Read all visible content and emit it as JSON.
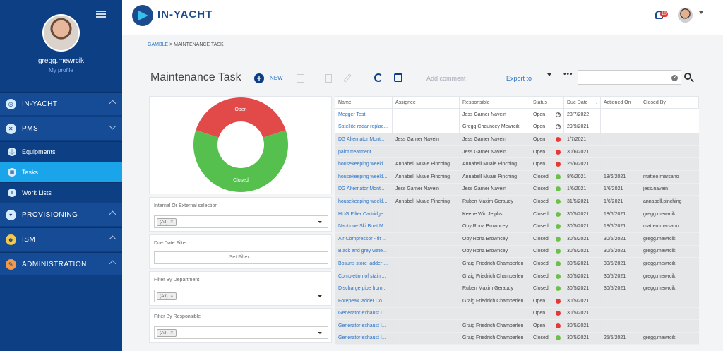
{
  "sidebar": {
    "username": "gregg.mewrcik",
    "my_profile": "My profile",
    "items": [
      {
        "label": "IN-YACHT",
        "icon": "compass-icon"
      },
      {
        "label": "PMS",
        "icon": "tools-icon"
      },
      {
        "label": "Equipments",
        "icon": "anchor-icon"
      },
      {
        "label": "Tasks",
        "icon": "calendar-icon"
      },
      {
        "label": "Work Lists",
        "icon": "list-icon"
      },
      {
        "label": "PROVISIONING",
        "icon": "basket-icon"
      },
      {
        "label": "ISM",
        "icon": "people-icon"
      },
      {
        "label": "ADMINISTRATION",
        "icon": "wrench-icon"
      }
    ]
  },
  "header": {
    "app_name": "IN-YACHT",
    "notification_count": "10"
  },
  "breadcrumb": {
    "parent": "GAMBLE",
    "sep": " > ",
    "current": "MAINTENANCE TASK"
  },
  "toolbar": {
    "title": "Maintenance Task",
    "new_label": "NEW",
    "add_comment": "Add comment",
    "export_to": "Export to",
    "more": "•••"
  },
  "chart_data": {
    "type": "pie",
    "style": "donut",
    "categories": [
      "Open",
      "Closed"
    ],
    "values": [
      40,
      60
    ],
    "colors": [
      "#e24a4a",
      "#56c04e"
    ]
  },
  "filters": {
    "internal_external": {
      "label": "Internal Or External selection",
      "chip": "(All)"
    },
    "due_date": {
      "label": "Due Date Filter",
      "button": "Set Filter..."
    },
    "department": {
      "label": "Filter By Department",
      "chip": "(All)"
    },
    "responsible": {
      "label": "Filter By Responsible",
      "chip": "(All)"
    }
  },
  "grid": {
    "columns": [
      "Name",
      "Assignee",
      "Responsible",
      "Status",
      "Due Date",
      "Actioned On",
      "Closed By"
    ],
    "rows": [
      {
        "name": "Megger Test",
        "assignee": "",
        "responsible": "Jess Garner Navein",
        "status": "Open",
        "ind": "pie",
        "due": "23/7/2022",
        "actioned": "",
        "closed_by": "",
        "grey": false
      },
      {
        "name": "Satellite radar replac...",
        "assignee": "",
        "responsible": "Gregg Chauncey Mewrcik",
        "status": "Open",
        "ind": "pie",
        "due": "29/9/2021",
        "actioned": "",
        "closed_by": "",
        "grey": false
      },
      {
        "name": "DG Alternator Mont...",
        "assignee": "Jess Garner Navein",
        "responsible": "Jess Garner Navein",
        "status": "Open",
        "ind": "red",
        "due": "1/7/2021",
        "actioned": "",
        "closed_by": "",
        "grey": true
      },
      {
        "name": "paint treatment",
        "assignee": "",
        "responsible": "Jess Garner Navein",
        "status": "Open",
        "ind": "red",
        "due": "30/6/2021",
        "actioned": "",
        "closed_by": "",
        "grey": true
      },
      {
        "name": "housekeeping weekl...",
        "assignee": "Annabell Muaie Pinching",
        "responsible": "Annabell Muaie Pinching",
        "status": "Open",
        "ind": "red",
        "due": "25/6/2021",
        "actioned": "",
        "closed_by": "",
        "grey": true
      },
      {
        "name": "housekeeping weekl...",
        "assignee": "Annabell Muaie Pinching",
        "responsible": "Annabell Muaie Pinching",
        "status": "Closed",
        "ind": "green",
        "due": "8/6/2021",
        "actioned": "18/6/2021",
        "closed_by": "matteo.marsano",
        "grey": true
      },
      {
        "name": "DG Alternator Mont...",
        "assignee": "Jess Garner Navein",
        "responsible": "Jess Garner Navein",
        "status": "Closed",
        "ind": "green",
        "due": "1/6/2021",
        "actioned": "1/6/2021",
        "closed_by": "jess.navein",
        "grey": true
      },
      {
        "name": "housekeeping weekl...",
        "assignee": "Annabell Muaie Pinching",
        "responsible": "Ruben Maxim Geraudy",
        "status": "Closed",
        "ind": "green",
        "due": "31/5/2021",
        "actioned": "1/6/2021",
        "closed_by": "annabell.pinching",
        "grey": true
      },
      {
        "name": "HUG Filter Cartridge...",
        "assignee": "",
        "responsible": "Keene Win Jelphs",
        "status": "Closed",
        "ind": "green",
        "due": "30/5/2021",
        "actioned": "18/6/2021",
        "closed_by": "gregg.mewrcik",
        "grey": true
      },
      {
        "name": "Nautique Ski Boat M...",
        "assignee": "",
        "responsible": "Oby Rona Browncey",
        "status": "Closed",
        "ind": "green",
        "due": "30/5/2021",
        "actioned": "18/6/2021",
        "closed_by": "matteo.marsano",
        "grey": true
      },
      {
        "name": "Air Compressor - fit ...",
        "assignee": "",
        "responsible": "Oby Rona Browncey",
        "status": "Closed",
        "ind": "green",
        "due": "30/5/2021",
        "actioned": "30/5/2021",
        "closed_by": "gregg.mewrcik",
        "grey": true
      },
      {
        "name": "Black and grey wate...",
        "assignee": "",
        "responsible": "Oby Rona Browncey",
        "status": "Closed",
        "ind": "green",
        "due": "30/5/2021",
        "actioned": "30/5/2021",
        "closed_by": "gregg.mewrcik",
        "grey": true
      },
      {
        "name": "Bosuns store ladder ...",
        "assignee": "",
        "responsible": "Graig Friedrich Champerlen",
        "status": "Closed",
        "ind": "green",
        "due": "30/5/2021",
        "actioned": "30/5/2021",
        "closed_by": "gregg.mewrcik",
        "grey": true
      },
      {
        "name": "Completion of stainl...",
        "assignee": "",
        "responsible": "Graig Friedrich Champerlen",
        "status": "Closed",
        "ind": "green",
        "due": "30/5/2021",
        "actioned": "30/5/2021",
        "closed_by": "gregg.mewrcik",
        "grey": true
      },
      {
        "name": "Discharge pipe from...",
        "assignee": "",
        "responsible": "Ruben Maxim Geraudy",
        "status": "Closed",
        "ind": "green",
        "due": "30/5/2021",
        "actioned": "30/5/2021",
        "closed_by": "gregg.mewrcik",
        "grey": true
      },
      {
        "name": "Forepeak ladder Co...",
        "assignee": "",
        "responsible": "Graig Friedrich Champerlen",
        "status": "Open",
        "ind": "red",
        "due": "30/5/2021",
        "actioned": "",
        "closed_by": "",
        "grey": true
      },
      {
        "name": "Generator exhaust I...",
        "assignee": "",
        "responsible": "",
        "status": "Open",
        "ind": "red",
        "due": "30/5/2021",
        "actioned": "",
        "closed_by": "",
        "grey": true
      },
      {
        "name": "Generator exhaust I...",
        "assignee": "",
        "responsible": "Graig Friedrich Champerlen",
        "status": "Open",
        "ind": "red",
        "due": "30/5/2021",
        "actioned": "",
        "closed_by": "",
        "grey": true
      },
      {
        "name": "Generator exhaust I...",
        "assignee": "",
        "responsible": "Graig Friedrich Champerlen",
        "status": "Closed",
        "ind": "green",
        "due": "30/5/2021",
        "actioned": "25/5/2021",
        "closed_by": "gregg.mewrcik",
        "grey": true
      }
    ]
  }
}
